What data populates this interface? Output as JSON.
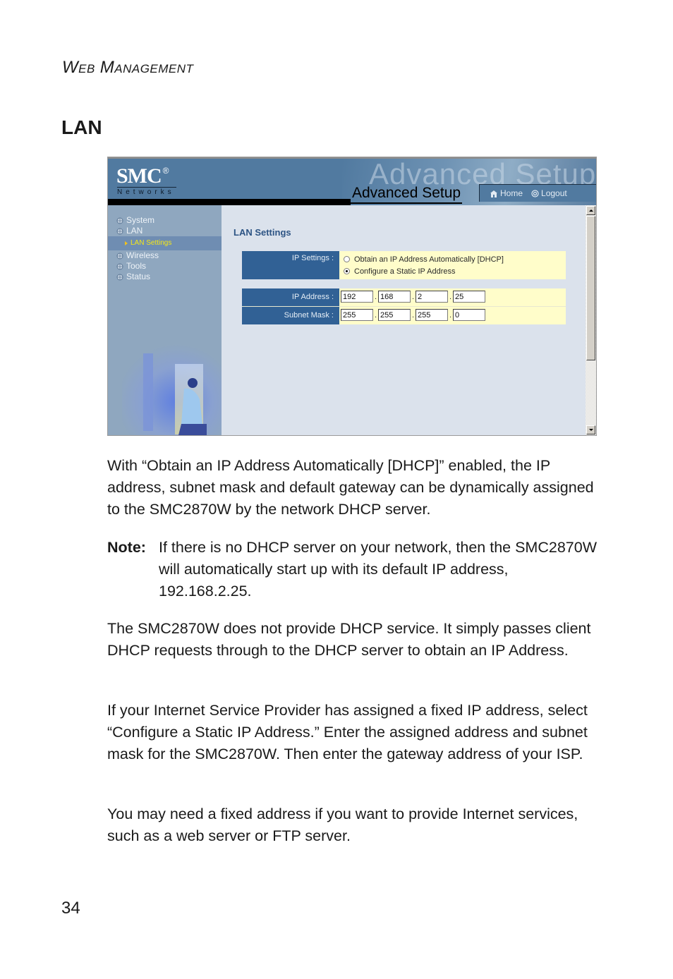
{
  "running_head": {
    "first": "W",
    "first_rest": "EB",
    "second": "M",
    "second_rest": "ANAGEMENT"
  },
  "section_title": "LAN",
  "screenshot": {
    "logo": {
      "brand": "SMC",
      "registered": "®",
      "sub": "Networks"
    },
    "watermark": "Advanced Setup",
    "page_heading": "Advanced Setup",
    "topnav": {
      "home": "Home",
      "logout": "Logout"
    },
    "sidebar": {
      "items": [
        {
          "label": "System",
          "icon": "globe-icon"
        },
        {
          "label": "LAN",
          "icon": "globe-icon"
        }
      ],
      "active_subitem": {
        "label": "LAN Settings",
        "icon": "arrow-right-icon"
      },
      "items_after": [
        {
          "label": "Wireless",
          "icon": "globe-icon"
        },
        {
          "label": "Tools",
          "icon": "globe-icon"
        },
        {
          "label": "Status",
          "icon": "globe-icon"
        }
      ]
    },
    "main": {
      "title": "LAN Settings",
      "ip_settings": {
        "label": "IP Settings :",
        "options": [
          {
            "label": "Obtain an IP Address Automatically [DHCP]",
            "selected": false
          },
          {
            "label": "Configure a Static IP Address",
            "selected": true
          }
        ]
      },
      "ip_address": {
        "label": "IP Address :",
        "octets": [
          "192",
          "168",
          "2",
          "25"
        ]
      },
      "subnet_mask": {
        "label": "Subnet Mask :",
        "octets": [
          "255",
          "255",
          "255",
          "0"
        ]
      },
      "separator": "."
    }
  },
  "paragraphs": {
    "p1": "With “Obtain an IP Address Automatically [DHCP]” enabled, the IP address, subnet mask and default gateway can be dynamically assigned to the SMC2870W by the network DHCP server.",
    "note_label": "Note:",
    "note_text": "If there is no DHCP server on your network, then the SMC2870W will automatically start up with its default IP address, 192.168.2.25.",
    "p2": "The SMC2870W does not provide DHCP service. It simply passes client DHCP requests through to the DHCP server to obtain an IP Address.",
    "p3": "If your Internet Service Provider has assigned a fixed IP address, select “Configure a Static IP Address.” Enter the assigned address and subnet mask for the SMC2870W. Then enter the gateway address of your ISP.",
    "p4": "You may need a fixed address if you want to provide Internet services, such as a web server or FTP server."
  },
  "page_number": "34"
}
